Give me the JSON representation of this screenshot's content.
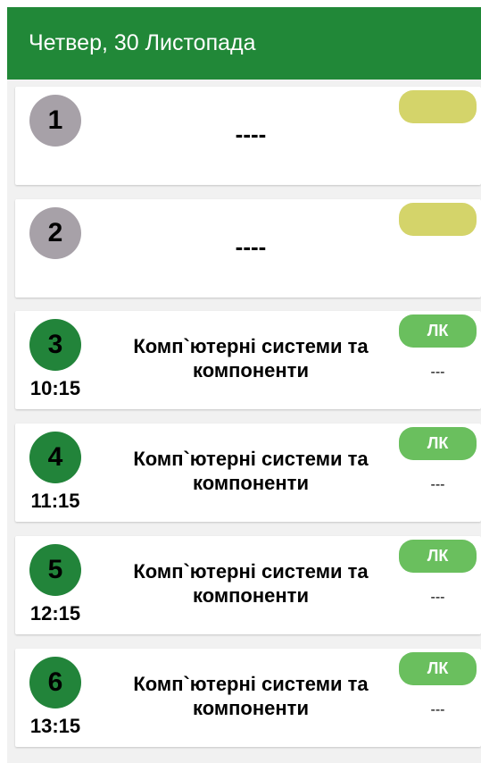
{
  "header": {
    "title": "Четвер, 30 Листопада"
  },
  "colors": {
    "header_bg": "#218838",
    "empty_circle": "#a7a1a8",
    "active_circle": "#22843a",
    "blank_badge": "#d4d46a",
    "lk_badge": "#6abf5e"
  },
  "lessons": [
    {
      "number": "1",
      "time": "",
      "subject": "----",
      "type": "",
      "room": ""
    },
    {
      "number": "2",
      "time": "",
      "subject": "----",
      "type": "",
      "room": ""
    },
    {
      "number": "3",
      "time": "10:15",
      "subject": "Комп`ютерні системи та компоненти",
      "type": "ЛК",
      "room": "---"
    },
    {
      "number": "4",
      "time": "11:15",
      "subject": "Комп`ютерні системи та компоненти",
      "type": "ЛК",
      "room": "---"
    },
    {
      "number": "5",
      "time": "12:15",
      "subject": "Комп`ютерні системи та компоненти",
      "type": "ЛК",
      "room": "---"
    },
    {
      "number": "6",
      "time": "13:15",
      "subject": "Комп`ютерні системи та компоненти",
      "type": "ЛК",
      "room": "---"
    }
  ]
}
